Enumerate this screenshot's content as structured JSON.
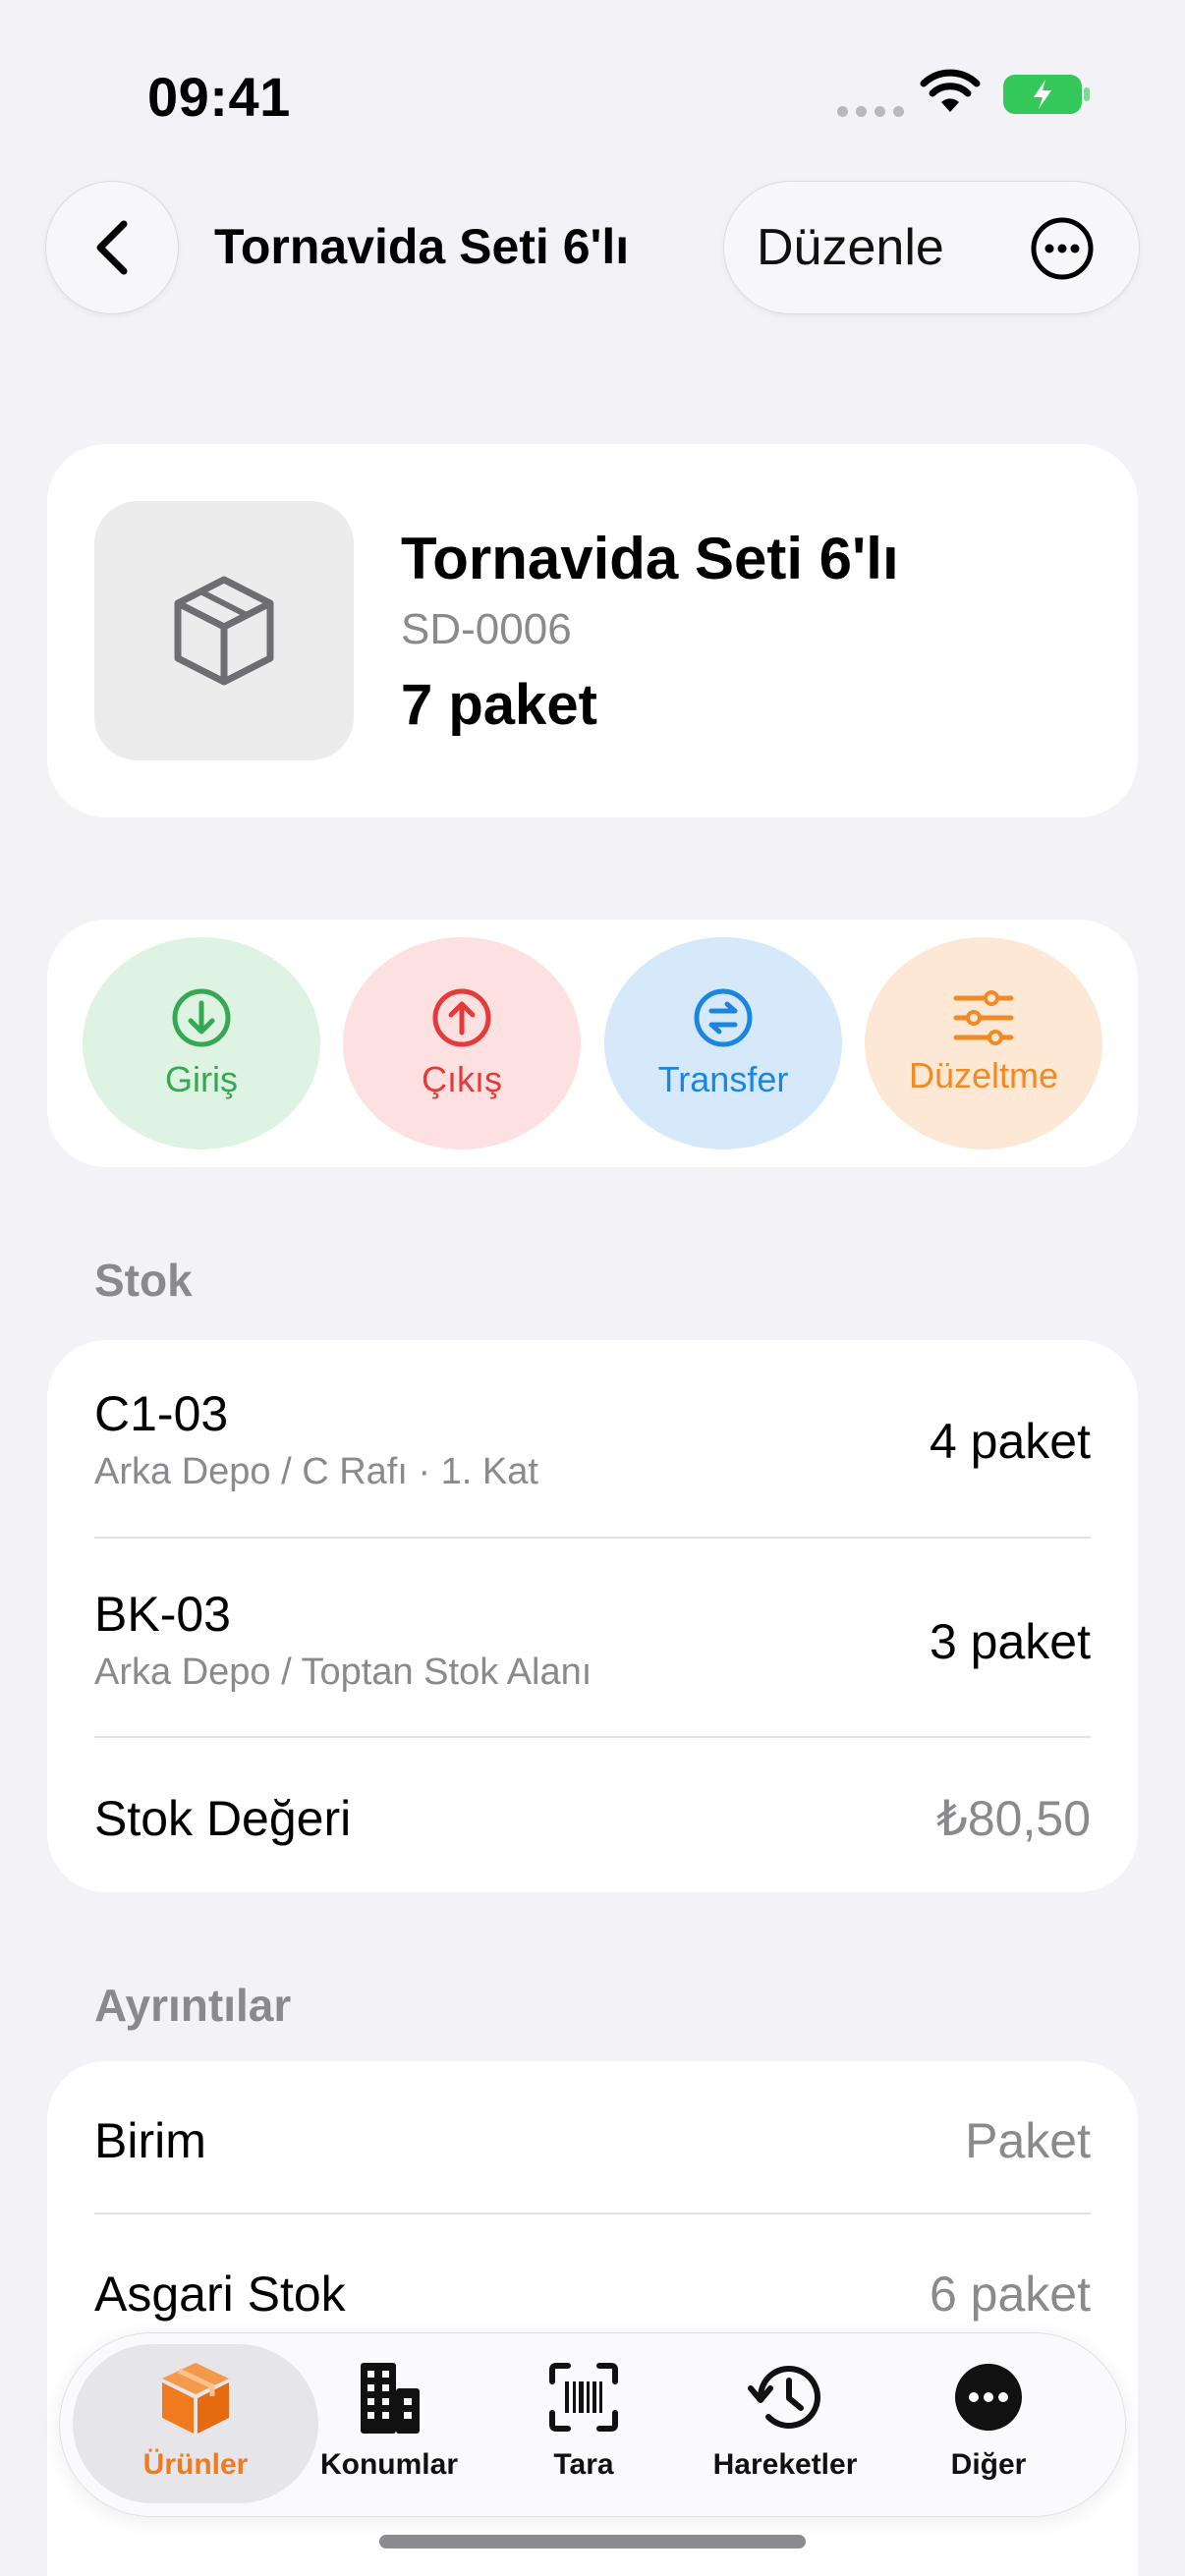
{
  "status_bar": {
    "time": "09:41"
  },
  "nav": {
    "title": "Tornavida Seti 6'lı",
    "edit_label": "Düzenle"
  },
  "product": {
    "name": "Tornavida Seti 6'lı",
    "sku": "SD-0006",
    "quantity": "7 paket",
    "image_icon": "box-icon"
  },
  "actions": [
    {
      "label": "Giriş",
      "icon": "arrow-down-circle-icon",
      "color": "#34a853"
    },
    {
      "label": "Çıkış",
      "icon": "arrow-up-circle-icon",
      "color": "#e5393a"
    },
    {
      "label": "Transfer",
      "icon": "arrows-swap-circle-icon",
      "color": "#1a86e0"
    },
    {
      "label": "Düzeltme",
      "icon": "sliders-icon",
      "color": "#f08a24"
    }
  ],
  "stock": {
    "header": "Stok",
    "locations": [
      {
        "code": "C1-03",
        "path": "Arka Depo / C Rafı · 1. Kat",
        "quantity": "4 paket"
      },
      {
        "code": "BK-03",
        "path": "Arka Depo / Toptan Stok Alanı",
        "quantity": "3 paket"
      }
    ],
    "value_label": "Stok Değeri",
    "value": "₺80,50"
  },
  "details": {
    "header": "Ayrıntılar",
    "rows": [
      {
        "label": "Birim",
        "value": "Paket"
      },
      {
        "label": "Asgari Stok",
        "value": "6 paket"
      }
    ]
  },
  "tabbar": {
    "accent": "#f07a1e",
    "items": [
      {
        "label": "Ürünler",
        "icon": "box-icon",
        "active": true
      },
      {
        "label": "Konumlar",
        "icon": "building-icon",
        "active": false
      },
      {
        "label": "Tara",
        "icon": "barcode-scan-icon",
        "active": false
      },
      {
        "label": "Hareketler",
        "icon": "history-icon",
        "active": false
      },
      {
        "label": "Diğer",
        "icon": "more-icon",
        "active": false
      }
    ]
  }
}
